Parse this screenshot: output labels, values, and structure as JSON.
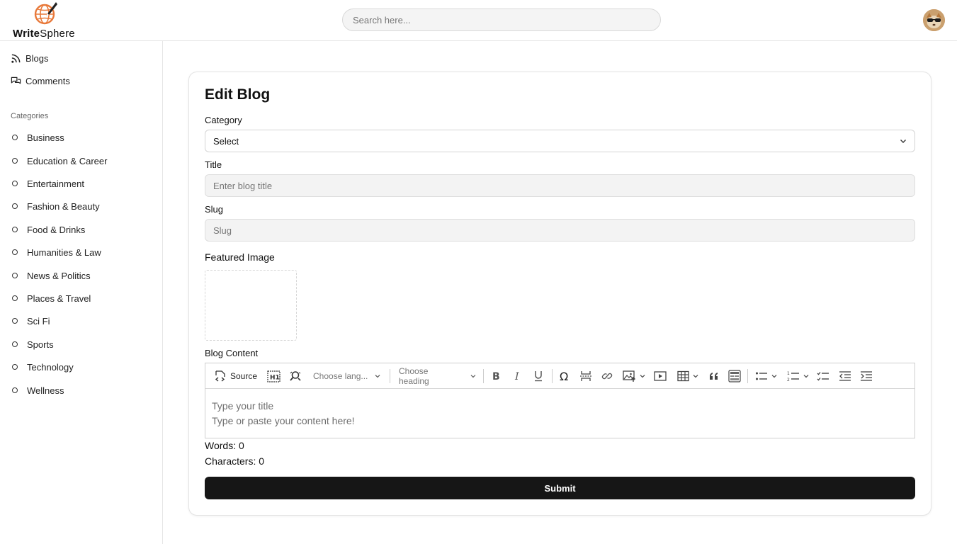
{
  "app": {
    "brand_bold": "Write",
    "brand_rest": "Sphere"
  },
  "header": {
    "search_placeholder": "Search here..."
  },
  "sidebar": {
    "nav": [
      {
        "label": "Blogs",
        "icon": "rss-icon"
      },
      {
        "label": "Comments",
        "icon": "comments-icon"
      }
    ],
    "categories_heading": "Categories",
    "categories": [
      "Business",
      "Education & Career",
      "Entertainment",
      "Fashion & Beauty",
      "Food & Drinks",
      "Humanities & Law",
      "News & Politics",
      "Places & Travel",
      "Sci Fi",
      "Sports",
      "Technology",
      "Wellness"
    ]
  },
  "form": {
    "title": "Edit Blog",
    "category_label": "Category",
    "category_value": "Select",
    "title_label": "Title",
    "title_placeholder": "Enter blog title",
    "slug_label": "Slug",
    "slug_placeholder": "Slug",
    "featured_image_label": "Featured Image",
    "content_label": "Blog Content",
    "submit_label": "Submit"
  },
  "editor": {
    "source_label": "Source",
    "language_placeholder": "Choose lang...",
    "heading_placeholder": "Choose heading",
    "title_placeholder": "Type your title",
    "content_placeholder": "Type or paste your content here!",
    "words_text": "Words: 0",
    "characters_text": "Characters: 0"
  },
  "colors": {
    "brand_orange": "#e8793a",
    "button_dark": "#161616",
    "link_blue": "#2f6fd6"
  }
}
